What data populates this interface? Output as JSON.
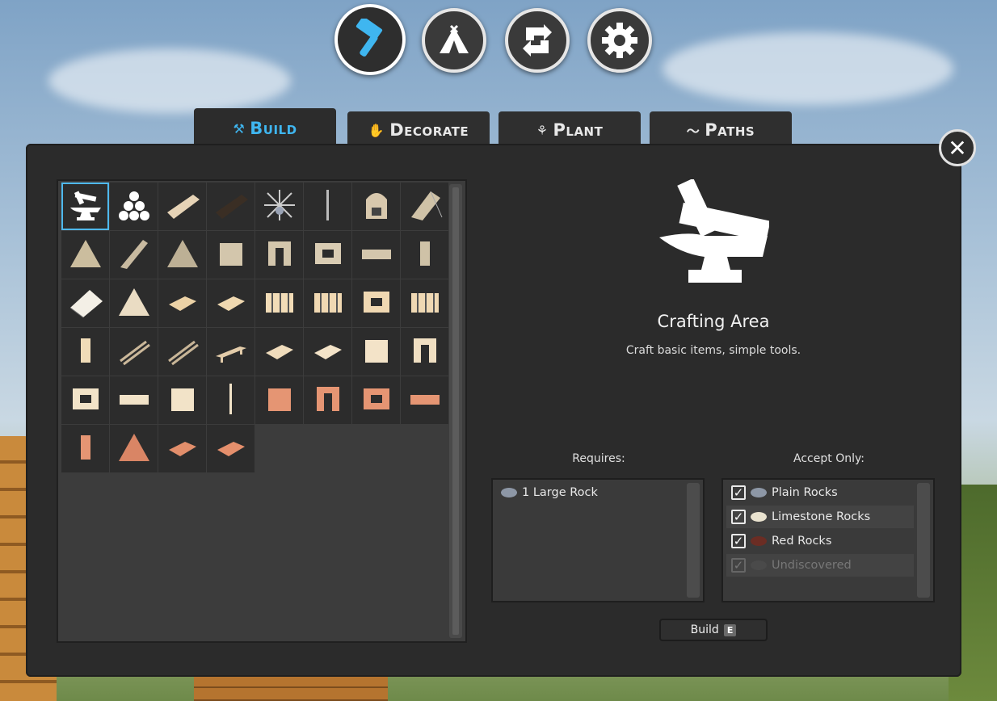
{
  "top_buttons": [
    {
      "name": "build-mode",
      "icon": "hammer-icon",
      "selected": true
    },
    {
      "name": "tent-mode",
      "icon": "tent-icon",
      "selected": false
    },
    {
      "name": "swap-mode",
      "icon": "swap-arrows-icon",
      "selected": false
    },
    {
      "name": "settings",
      "icon": "gear-icon",
      "selected": false
    }
  ],
  "tabs": [
    {
      "label": "Build",
      "icon": "hammer-icon",
      "active": true
    },
    {
      "label": "Decorate",
      "icon": "hand-icon",
      "active": false
    },
    {
      "label": "Plant",
      "icon": "sprout-icon",
      "active": false
    },
    {
      "label": "Paths",
      "icon": "path-icon",
      "active": false
    }
  ],
  "selected_item": {
    "title": "Crafting Area",
    "description": "Craft basic items, simple tools.",
    "icon": "anvil-icon"
  },
  "requires": {
    "label": "Requires:",
    "items": [
      "1 Large Rock"
    ]
  },
  "accept_only": {
    "label": "Accept Only:",
    "items": [
      {
        "label": "Plain Rocks",
        "checked": true,
        "color": "#8d97a6"
      },
      {
        "label": "Limestone Rocks",
        "checked": true,
        "color": "#e9e2cf"
      },
      {
        "label": "Red Rocks",
        "checked": true,
        "color": "#6b2d24"
      },
      {
        "label": "Undiscovered",
        "checked": true,
        "disabled": true,
        "color": "#4a4a4a"
      }
    ]
  },
  "build_button": {
    "label": "Build",
    "key": "E"
  },
  "colors": {
    "accent": "#3fb6f0",
    "panel": "#2b2b2b"
  }
}
